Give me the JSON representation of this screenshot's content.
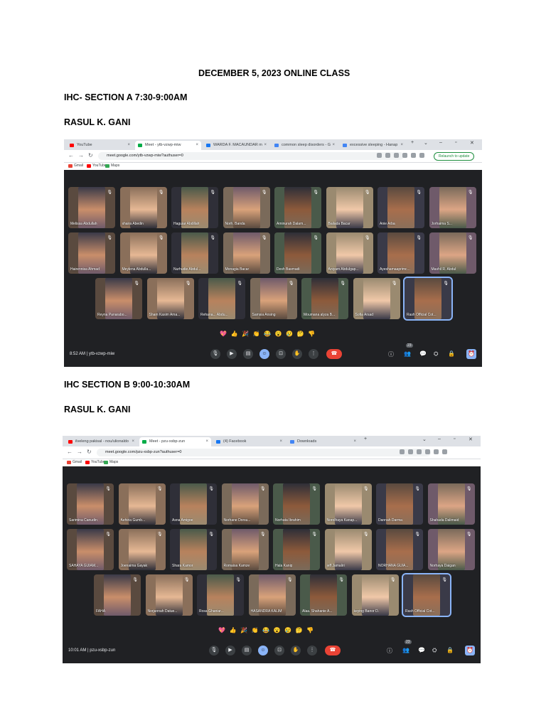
{
  "heading": "DECEMBER 5, 2023 ONLINE CLASS",
  "section_a": {
    "title": "IHC- SECTION A 7:30-9:00AM",
    "teacher": "RASUL K. GANI"
  },
  "section_b": {
    "title": "IHC SECTION B 9:00-10:30AM",
    "teacher": "RASUL K. GANI"
  },
  "shot1": {
    "tabs": [
      "YouTube",
      "Meet - ytb-vzwp-miw",
      "WARDA F. MACAUNDAR m",
      "common sleep disorders - G",
      "excessive sleeping - Hanap"
    ],
    "url": "meet.google.com/ytb-vzwp-miw?authuser=0",
    "relaunch": "Relaunch to update",
    "bookmarks": [
      "Gmail",
      "YouTube",
      "Maps"
    ],
    "participants": [
      "Melissa Abdullah",
      "shaira Abedin",
      "Haguiar Abdillah",
      "Norh. Banda",
      "Aminurah Dalam...",
      "Bailada Bacar",
      "Anie Arba",
      "Jorhaima S...",
      "Hairennisa Ahmad",
      "Meylena Abdulla...",
      "Nurhudie Abdul...",
      "Monagia Bacar",
      "Desh Basmadi",
      "Aniyam Abdulgap...",
      "Ayeshamaaprimc...",
      "Mashil R. Abdul",
      "Reyna Panarabo...",
      "Sham Kasim Ama...",
      "Rehana... Abdu...",
      "Samsia Ansing",
      "Moumana alyza B...",
      "Sofia Arsad",
      "Rash Official Cot..."
    ],
    "time": "8:52 AM",
    "code": "ytb-vzwp-miw",
    "people_count": "23"
  },
  "shot2": {
    "tabs": [
      "ilveleng pakisal - nou/ulionaldo",
      "Meet - pzu-xsbp-zun",
      "(4) Facebook",
      "Downloads"
    ],
    "url": "meet.google.com/pzu-xsbp-zun?authuser=0",
    "bookmarks": [
      "Gmail",
      "YouTube",
      "Maps"
    ],
    "participants": [
      "Sarimina Canudin",
      "Aehiria Gumb...",
      "Asna Amigoe",
      "Norhane Dorsu...",
      "Norhata Ibrahim",
      "Norolhaya Kanap...",
      "Dannah Darma",
      "Shahada Dalimaid",
      "SAHAYA GUIAM...",
      "Joenaima Gayak",
      "Shara Kamor",
      "Romaisa Kamze",
      "Hala Kanip",
      "jeff Jamaliri",
      "NORHANA GUIA...",
      "Norhaya Daigan",
      "FAHA",
      "Norjannah Datue...",
      "Rosa Ghaniar...",
      "HASANDRA KALIM",
      "Alaa. Shahanie A...",
      "keying Banor D.",
      "Rash Official Cot..."
    ],
    "time": "10:01 AM",
    "code": "pzu-xsbp-zun",
    "people_count": "23"
  },
  "reactions": [
    "💖",
    "👍",
    "🎉",
    "👏",
    "😂",
    "😮",
    "😢",
    "🤔",
    "👎"
  ],
  "colors": {
    "meet_bg": "#202124",
    "tile_bg": "#3c4043",
    "hangup": "#ea4335",
    "accent": "#8ab4f8"
  }
}
